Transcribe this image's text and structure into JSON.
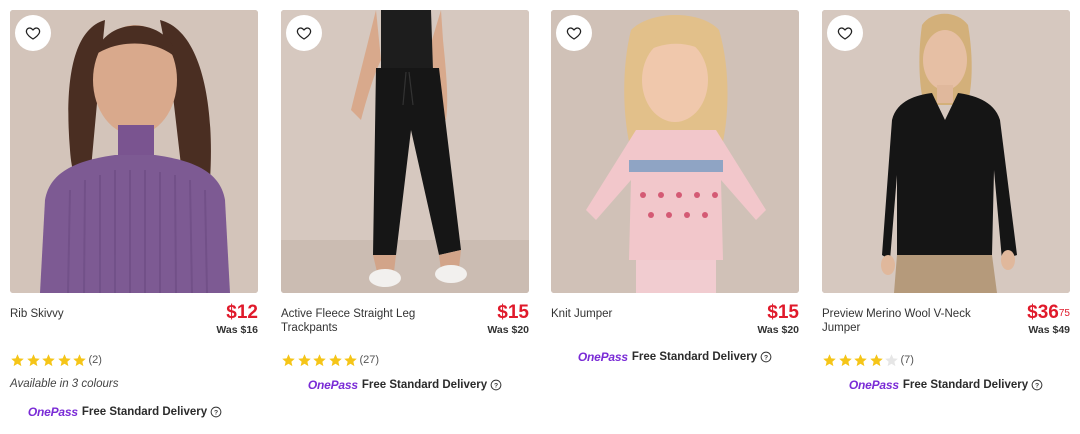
{
  "products": [
    {
      "name": "Rib Skivvy",
      "price": "$12",
      "price_cents": "",
      "was": "Was $16",
      "rating": 5,
      "rating_count": "(2)",
      "colours": "Available in 3 colours",
      "onepass_label": "OnePass",
      "delivery": "Free Standard Delivery"
    },
    {
      "name": "Active Fleece Straight Leg Trackpants",
      "price": "$15",
      "price_cents": "",
      "was": "Was $20",
      "rating": 5,
      "rating_count": "(27)",
      "onepass_label": "OnePass",
      "delivery": "Free Standard Delivery"
    },
    {
      "name": "Knit Jumper",
      "price": "$15",
      "price_cents": "",
      "was": "Was $20",
      "onepass_label": "OnePass",
      "delivery": "Free Standard Delivery"
    },
    {
      "name": "Preview Merino Wool V-Neck Jumper",
      "price": "$36",
      "price_cents": "75",
      "was": "Was $49",
      "rating": 4,
      "rating_count": "(7)",
      "onepass_label": "OnePass",
      "delivery": "Free Standard Delivery"
    }
  ],
  "colors": {
    "price_red": "#e01a2b",
    "star_gold": "#f5c518",
    "onepass_purple": "#7a2bd6"
  },
  "icons": {
    "wishlist": "heart-outline-icon",
    "star": "star-icon",
    "info": "info-circle-icon"
  }
}
